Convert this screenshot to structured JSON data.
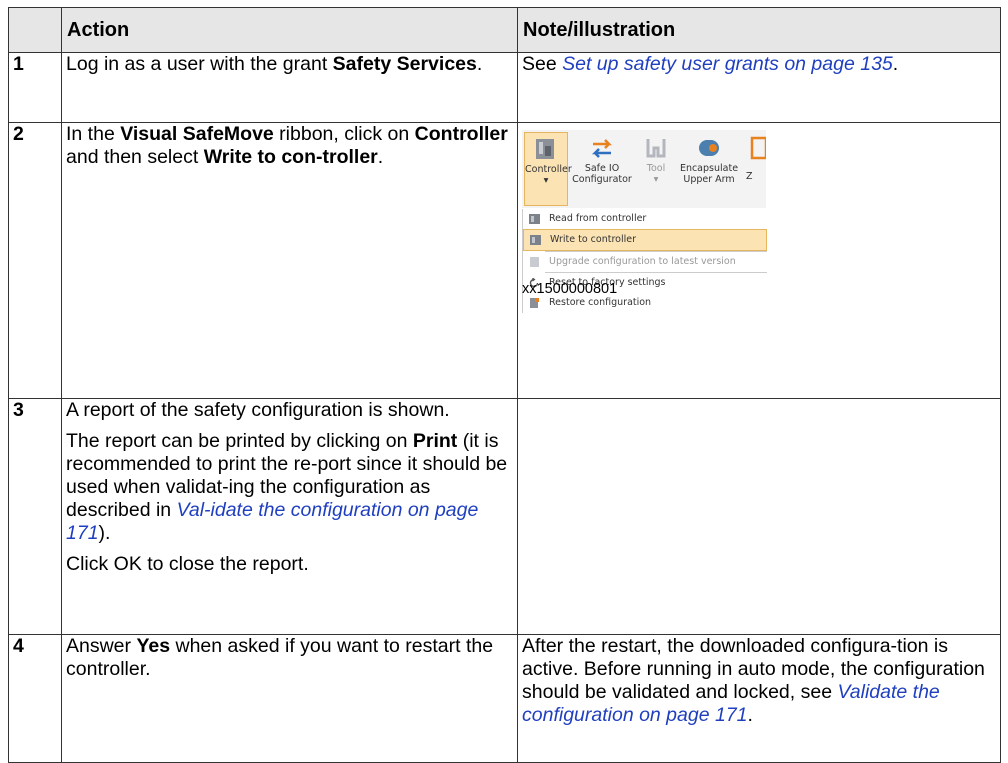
{
  "table": {
    "headers": [
      "",
      "Action",
      "Note/illustration"
    ],
    "rows": [
      {
        "num": "1",
        "action_parts": [
          "Log in as a user with the grant ",
          "Safety Services",
          "."
        ],
        "note_parts": [
          "See ",
          "Set up safety user grants on page 135",
          "."
        ]
      },
      {
        "num": "2",
        "action_parts": [
          "In the ",
          "Visual SafeMove",
          " ribbon, click on ",
          "Controller",
          " and then select ",
          "Write to con-troller",
          "."
        ],
        "illustration": {
          "ribbon_buttons": [
            {
              "label": "Controller",
              "sub": "▾",
              "state": "active"
            },
            {
              "label": "Safe IO",
              "sub": "Configurator",
              "state": "normal"
            },
            {
              "label": "Tool",
              "sub": "▾",
              "state": "disabled"
            },
            {
              "label": "Encapsulate",
              "sub": "Upper Arm",
              "state": "normal"
            },
            {
              "label": "Z",
              "sub": "",
              "state": "normal"
            }
          ],
          "menu_items": [
            {
              "label": "Read from controller",
              "state": "normal"
            },
            {
              "label": "Write to controller",
              "state": "highlighted"
            },
            {
              "label": "Upgrade configuration to latest version",
              "state": "disabled"
            },
            {
              "label": "Reset to factory settings",
              "state": "normal"
            },
            {
              "label": "Restore configuration",
              "state": "normal"
            }
          ],
          "caption": "xx1500000801"
        }
      },
      {
        "num": "3",
        "action_p1": "A report of the safety configuration is shown.",
        "action_p2_parts": [
          "The report can be printed by clicking on ",
          "Print",
          " (it is recommended to print the re-port since it should be used when validat-ing the configuration as described in ",
          "Val-idate the configuration on page 171",
          ")."
        ],
        "action_p3": "Click OK to close the report."
      },
      {
        "num": "4",
        "action_parts": [
          "Answer ",
          "Yes",
          " when asked if you want to restart the controller."
        ],
        "note_parts": [
          "After the restart, the downloaded configura-tion is active. Before running in auto mode, the configuration should be validated and locked, see ",
          "Validate the configuration on page 171",
          "."
        ]
      }
    ]
  },
  "colors": {
    "link": "#1f3fbf",
    "header_bg": "#e6e6e6",
    "highlight": "#fbe3b4"
  }
}
